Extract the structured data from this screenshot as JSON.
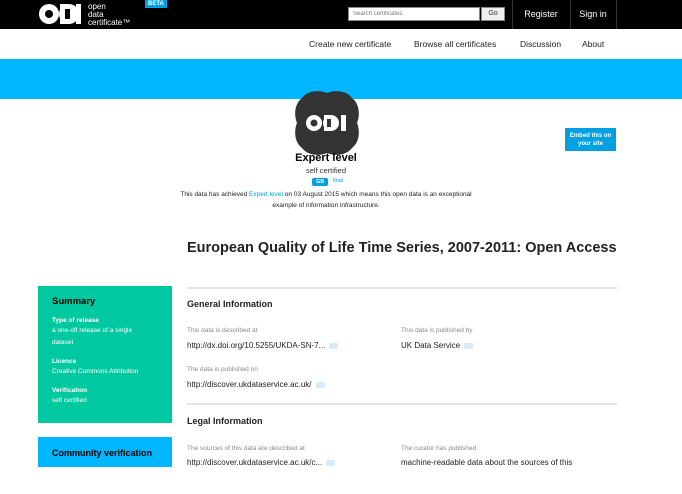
{
  "header": {
    "logo_text": [
      "open",
      "data",
      "certificate™"
    ],
    "beta": "BETA",
    "search_placeholder": "Search certificates",
    "search_button": "Go",
    "register": "Register",
    "sign_in": "Sign in"
  },
  "nav": {
    "items": [
      "Create new certificate",
      "Browse all certificates",
      "Discussion",
      "About"
    ]
  },
  "certificate": {
    "level": "Expert level",
    "status": "self certified",
    "jurisdiction": "GB",
    "state": "final",
    "achieved_prefix": "This data has achieved ",
    "achieved_level": "Expert level",
    "achieved_suffix": " on 03 August 2015 which means this open data is an exceptional example of information infrastructure.",
    "embed_button": "Embed this on your site"
  },
  "dataset": {
    "title": "European Quality of Life Time Series, 2007-2011: Open Access"
  },
  "general": {
    "heading": "General Information",
    "described_label": "This data is described at",
    "described_value": "http://dx.doi.org/10.5255/UKDA-SN-7...",
    "publisher_label": "This data is published by",
    "publisher_value": "UK Data Service",
    "published_on_label": "The data is published on",
    "published_on_value": "http://discover.ukdataservice.ac.uk/"
  },
  "legal": {
    "heading": "Legal Information",
    "sources_label": "The sources of this data are described at",
    "sources_value": "http://discover.ukdataservice.ac.uk/c...",
    "curator_label": "The curator has published",
    "curator_value": "machine-readable data about the sources of this"
  },
  "summary": {
    "heading": "Summary",
    "type_label": "Type of release",
    "type_value": "a one-off release of a single dataset",
    "licence_label": "Licence",
    "licence_value": "Creative Commons Attribution",
    "verification_label": "Verification",
    "verification_value": "self certified"
  },
  "community": {
    "heading": "Community verification"
  },
  "colors": {
    "brand_blue": "#00b7ff",
    "accent_blue": "#00a0e3",
    "summary_green": "#00c8a0"
  }
}
